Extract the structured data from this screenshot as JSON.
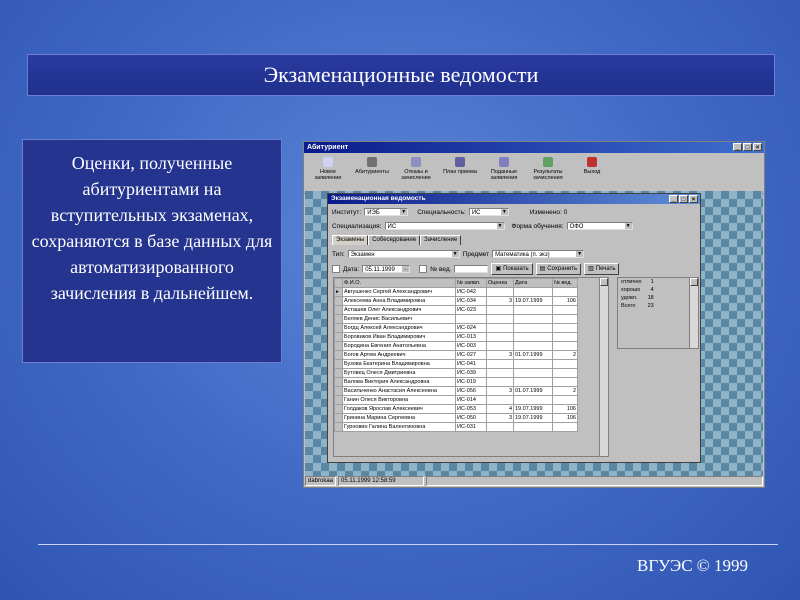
{
  "slide": {
    "title": "Экзаменационные ведомости",
    "description": "Оценки, полученные абитуриентами на вступительных экзаменах, сохраняются в базе данных для автоматизированного зачисления в дальнейшем.",
    "footer": "ВГУЭС © 1999"
  },
  "app": {
    "title": "Абитуриент",
    "toolbar": [
      {
        "label": "Новое заявление",
        "icon": "new-document-icon"
      },
      {
        "label": "Абитуриенты",
        "icon": "people-icon"
      },
      {
        "label": "Отказы и зачисление",
        "icon": "refusal-icon"
      },
      {
        "label": "План приема",
        "icon": "plan-icon"
      },
      {
        "label": "Поданные заявления",
        "icon": "applications-icon"
      },
      {
        "label": "Результаты зачисления",
        "icon": "results-icon"
      },
      {
        "label": "Выход",
        "icon": "exit-icon"
      }
    ],
    "status": {
      "user": "dabrokaa",
      "datetime": "05.11.1999 12:58:59"
    }
  },
  "dialog": {
    "title": "Экзаменационная ведомость",
    "institute_label": "Институт:",
    "institute_value": "ИЭБ",
    "specialty_label": "Специальность:",
    "specialty_value": "ИС",
    "changed_label": "Изменено: 0",
    "specialization_label": "Специализация:",
    "specialization_value": "ИС",
    "study_form_label": "Форма обучения:",
    "study_form_value": "ОФО",
    "tabs": [
      "Экзамены",
      "Собеседование",
      "Зачисление"
    ],
    "type_label": "Тип:",
    "type_value": "Экзамен",
    "subject_label": "Предмет",
    "subject_value": "Математика (п. экз)",
    "date_label": "Дата:",
    "date_value": "05.11.1999",
    "vedomost_label": "№ вед.",
    "show_button": "Показать",
    "save_button": "Сохранить",
    "print_button": "Печать",
    "columns": [
      "Ф.И.О.",
      "№ заявл.",
      "Оценка",
      "Дата",
      "№ вед."
    ],
    "rows": [
      {
        "fio": "Авгушенко Сергей Александрович",
        "num": "ИС-042",
        "grade": "",
        "date": "",
        "ved": ""
      },
      {
        "fio": "Алексеева Анна Владимировна",
        "num": "ИС-034",
        "grade": "3",
        "date": "19.07.1999",
        "ved": "106"
      },
      {
        "fio": "Асташев Олег Александрович",
        "num": "ИС-023",
        "grade": "",
        "date": "",
        "ved": ""
      },
      {
        "fio": "Беляев Денис Васильевич",
        "num": "",
        "grade": "",
        "date": "",
        "ved": ""
      },
      {
        "fio": "Богдц Алексей Александрович",
        "num": "ИС-024",
        "grade": "",
        "date": "",
        "ved": ""
      },
      {
        "fio": "Боровиков Иван Владимирович",
        "num": "ИС-013",
        "grade": "",
        "date": "",
        "ved": ""
      },
      {
        "fio": "Бородина Евгения Анатольевна",
        "num": "ИС-003",
        "grade": "",
        "date": "",
        "ved": ""
      },
      {
        "fio": "Богов Артем Андреевич",
        "num": "ИС-027",
        "grade": "3",
        "date": "01.07.1999",
        "ved": "2"
      },
      {
        "fio": "Бузова Екатерина Владимировна",
        "num": "ИС-041",
        "grade": "",
        "date": "",
        "ved": ""
      },
      {
        "fio": "Бутовец Олеся Дмитриевна",
        "num": "ИС-039",
        "grade": "",
        "date": "",
        "ved": ""
      },
      {
        "fio": "Валова Виктория Александровна",
        "num": "ИС-019",
        "grade": "",
        "date": "",
        "ved": ""
      },
      {
        "fio": "Васильченко Анастасия Алексеевна",
        "num": "ИС-056",
        "grade": "3",
        "date": "01.07.1999",
        "ved": "2"
      },
      {
        "fio": "Ганин Олеся Викторовна",
        "num": "ИС-014",
        "grade": "",
        "date": "",
        "ved": ""
      },
      {
        "fio": "Голдаков Ярослав Алексеевич",
        "num": "ИС-053",
        "grade": "4",
        "date": "19.07.1999",
        "ved": "106"
      },
      {
        "fio": "Гринина Марина Сергеевна",
        "num": "ИС-050",
        "grade": "3",
        "date": "19.07.1999",
        "ved": "106"
      },
      {
        "fio": "Гурновин Галина Валентиновна",
        "num": "ИС-031",
        "grade": "",
        "date": "",
        "ved": ""
      }
    ],
    "stats": [
      {
        "label": "отлично",
        "value": "1"
      },
      {
        "label": "хорошо",
        "value": "4"
      },
      {
        "label": "удовл.",
        "value": "18"
      },
      {
        "label": "Всего",
        "value": "23"
      }
    ]
  }
}
